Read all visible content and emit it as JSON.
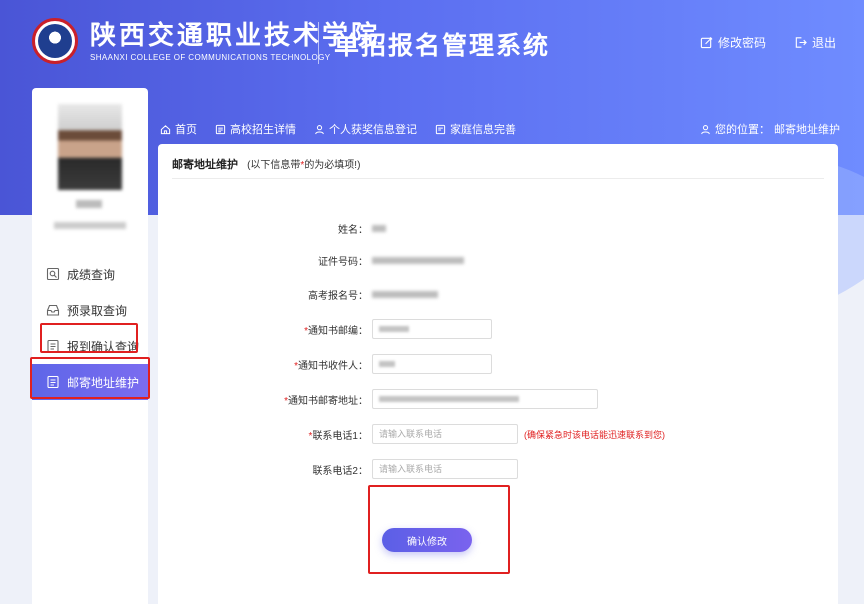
{
  "header": {
    "school_name_cn": "陕西交通职业技术学院",
    "school_name_en": "SHAANXI COLLEGE OF COMMUNICATIONS TECHNOLOGY",
    "system_title": "单招报名管理系统",
    "change_password": "修改密码",
    "logout": "退出"
  },
  "sidebar": {
    "items": [
      {
        "label": "成绩查询",
        "icon": "search-doc-icon"
      },
      {
        "label": "预录取查询",
        "icon": "inbox-icon"
      },
      {
        "label": "报到确认查询",
        "icon": "list-doc-icon"
      },
      {
        "label": "邮寄地址维护",
        "icon": "list-doc-icon"
      }
    ],
    "active_index": 3
  },
  "nav": {
    "items": [
      "首页",
      "高校招生详情",
      "个人获奖信息登记",
      "家庭信息完善"
    ],
    "location_label": "您的位置：",
    "location_value": "邮寄地址维护"
  },
  "form": {
    "title": "邮寄地址维护",
    "note_prefix": "(以下信息带",
    "note_star": "*",
    "note_suffix": "的为必填项!)",
    "fields": {
      "name_label": "姓名：",
      "id_label": "证件号码：",
      "exam_no_label": "高考报名号：",
      "postcode_label": "通知书邮编：",
      "recipient_label": "通知书收件人：",
      "address_label": "通知书邮寄地址：",
      "phone1_label": "联系电话1：",
      "phone1_placeholder": "请输入联系电话",
      "phone1_hint": "(确保紧急时该电话能迅速联系到您)",
      "phone2_label": "联系电话2：",
      "phone2_placeholder": "请输入联系电话",
      "required_star": "*"
    },
    "confirm_button": "确认修改"
  },
  "colors": {
    "accent": "#5e66e8",
    "header_gradient_start": "#4a55d6",
    "header_gradient_end": "#6f8cff",
    "required": "#e02020",
    "highlight_box": "#e02020"
  }
}
